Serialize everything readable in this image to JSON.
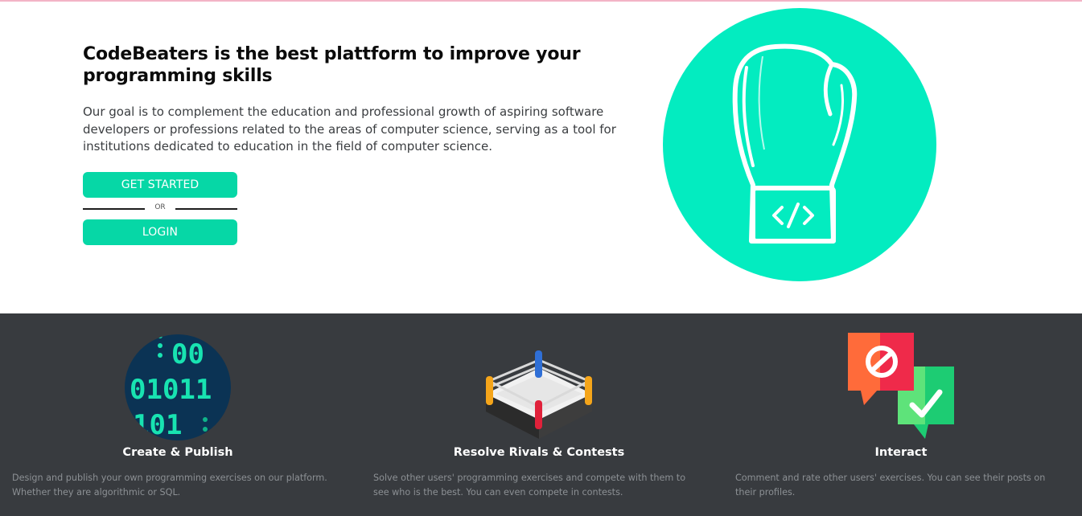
{
  "hero": {
    "title": "CodeBeaters is the best plattform to improve your programming skills",
    "description": "Our goal is to complement the education and professional growth of aspiring software developers or professions related to the areas of computer science, serving as a tool for institutions dedicated to education in the field of computer science.",
    "get_started_label": "GET STARTED",
    "or_label": "OR",
    "login_label": "LOGIN",
    "illustration_icon": "boxing-glove-code-icon"
  },
  "features": [
    {
      "icon": "binary-code-icon",
      "title": "Create & Publish",
      "description": "Design and publish your own programming exercises on our platform. Whether they are algorithmic or SQL."
    },
    {
      "icon": "boxing-ring-icon",
      "title": "Resolve Rivals & Contests",
      "description": "Solve other users' programming exercises and compete with them to see who is the best. You can even compete in contests."
    },
    {
      "icon": "chat-bubbles-icon",
      "title": "Interact",
      "description": "Comment and rate other users' exercises. You can see their posts on their profiles."
    }
  ],
  "colors": {
    "accent": "#06d7a6",
    "circle": "#03ecc0",
    "dark_band": "#383b3f"
  }
}
